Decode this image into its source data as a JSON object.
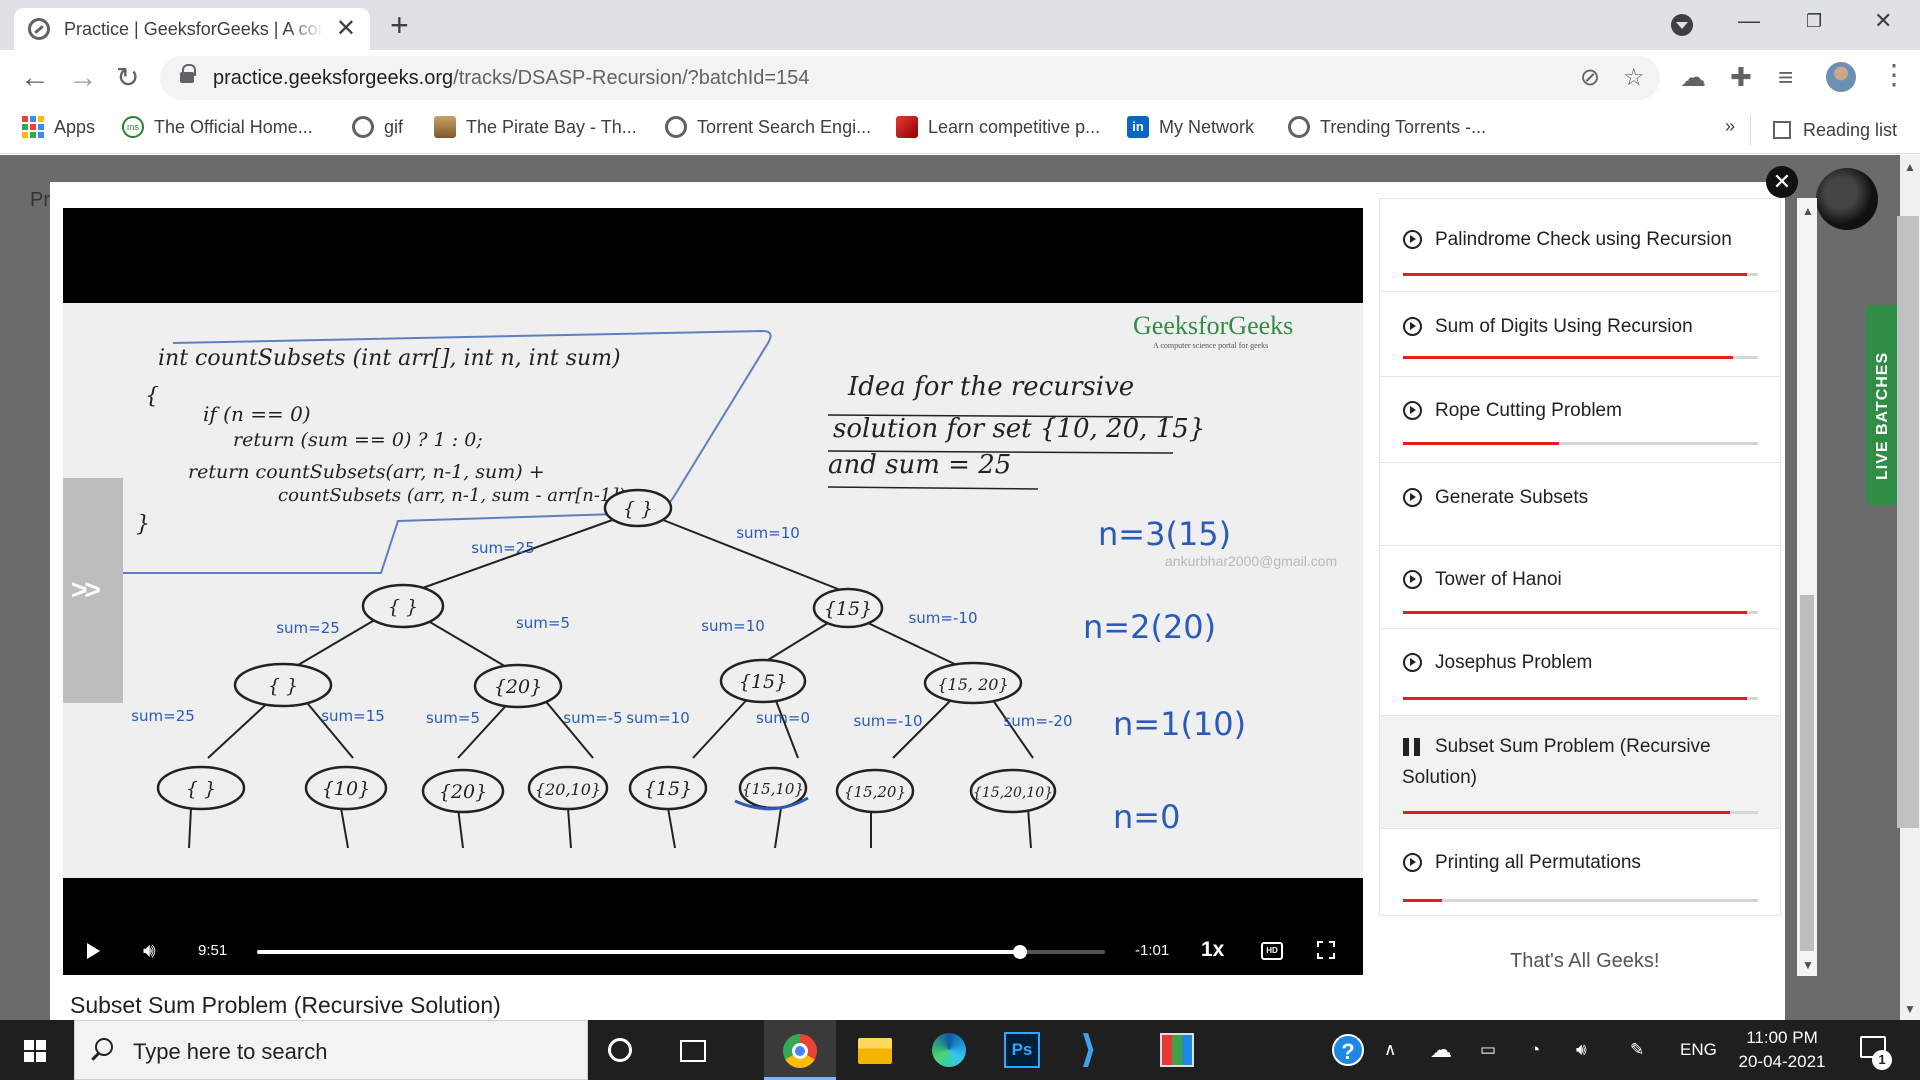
{
  "browser": {
    "tab_title": "Practice | GeeksforGeeks | A computer science portal for geeks",
    "url_host": "practice.geeksforgeeks.org",
    "url_path": "/tracks/DSASP-Recursion/?batchId=154",
    "bookmarks": [
      {
        "label": "Apps",
        "icon": "apps-grid-icon"
      },
      {
        "label": "The Official Home...",
        "icon": "site-icon"
      },
      {
        "label": "gif",
        "icon": "globe-icon"
      },
      {
        "label": "The Pirate Bay - Th...",
        "icon": "ship-icon"
      },
      {
        "label": "Torrent Search Engi...",
        "icon": "globe-icon"
      },
      {
        "label": "Learn competitive p...",
        "icon": "cube-icon"
      },
      {
        "label": "My Network",
        "icon": "linkedin-icon"
      },
      {
        "label": "Trending Torrents -...",
        "icon": "globe-icon"
      }
    ],
    "overflow": "»",
    "reading_list": "Reading list"
  },
  "page": {
    "background_title": "Pr",
    "live_batches": "LIVE BATCHES"
  },
  "video": {
    "logo": "GeeksforGeeks",
    "logo_sub": "A computer science portal for geeks",
    "watermark": "ankurbhar2000@gmail.com",
    "side_arrow": ">>",
    "current_time": "9:51",
    "remaining_time": "-1:01",
    "progress": 0.9,
    "speed": "1x",
    "hd": "HD",
    "title": "Subset Sum Problem (Recursive Solution)",
    "whiteboard": {
      "code": [
        "int  countSubsets (int arr[], int n, int sum)",
        "{",
        "if (n == 0)",
        "return (sum == 0) ? 1 : 0;",
        "return countSubsets(arr, n-1, sum) +",
        "countSubsets (arr, n-1, sum - arr[n-1]);",
        "}"
      ],
      "idea": [
        "Idea for the recursive",
        "solution for set {10, 20, 15}",
        "and sum = 25"
      ],
      "levels": [
        "n=3(15)",
        "n=2(20)",
        "n=1(10)",
        "n=0"
      ],
      "nodes": [
        "{ }",
        "{ }",
        "{15}",
        "{ }",
        "{20}",
        "{15}",
        "{15, 20}",
        "{ }",
        "{10}",
        "{20}",
        "{20,10}",
        "{15}",
        "{15,10}",
        "{15,20}",
        "{15,20,10}"
      ],
      "edges": [
        "sum=25",
        "sum=10",
        "sum=25",
        "sum=5",
        "sum=10",
        "sum=-10",
        "sum=25",
        "sum=15",
        "sum=5",
        "sum=-5",
        "sum=10",
        "sum=0",
        "sum=-10",
        "sum=-20"
      ]
    }
  },
  "playlist": {
    "items": [
      {
        "label": "Palindrome Check using Recursion",
        "progress": 0.97,
        "state": "watched"
      },
      {
        "label": "Sum of Digits Using Recursion",
        "progress": 0.93,
        "state": "watched"
      },
      {
        "label": "Rope Cutting Problem",
        "progress": 0.44,
        "state": "partial"
      },
      {
        "label": "Generate Subsets",
        "progress": 0,
        "state": "unwatched"
      },
      {
        "label": "Tower of Hanoi",
        "progress": 0.97,
        "state": "watched"
      },
      {
        "label": "Josephus Problem",
        "progress": 0.97,
        "state": "watched"
      },
      {
        "label": "Subset Sum Problem (Recursive Solution)",
        "progress": 0.92,
        "state": "playing"
      },
      {
        "label": "Printing all Permutations",
        "progress": 0.11,
        "state": "partial"
      }
    ],
    "footer": "That's All Geeks!"
  },
  "taskbar": {
    "search_placeholder": "Type here to search",
    "language": "ENG",
    "time": "11:00 PM",
    "date": "20-04-2021",
    "notification_count": "1",
    "apps": [
      "cortana-icon",
      "task-view-icon",
      "chrome-icon",
      "file-explorer-icon",
      "edge-icon",
      "photoshop-icon",
      "vscode-icon",
      "winrar-icon"
    ]
  },
  "colors": {
    "gfg_green": "#2f8d46",
    "progress_red": "#e41d1d",
    "marker_blue": "#2a5bb8",
    "taskbar": "#1f1f1f"
  }
}
